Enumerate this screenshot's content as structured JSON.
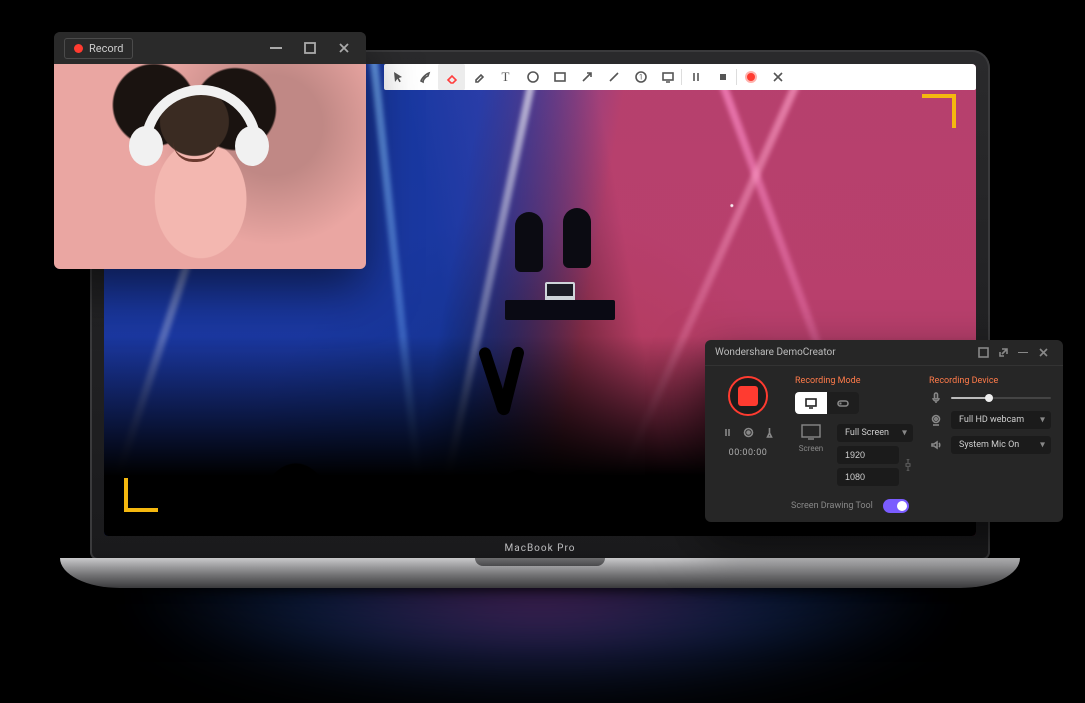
{
  "laptop": {
    "brand_label": "MacBook Pro"
  },
  "record_window": {
    "record_label": "Record",
    "colors": {
      "record_red": "#ff3b30"
    }
  },
  "annotation_toolbar": {
    "tools": [
      "cursor",
      "brush",
      "eraser",
      "highlighter",
      "text",
      "circle",
      "rectangle",
      "arrow",
      "line",
      "step-number",
      "whiteboard"
    ]
  },
  "panel": {
    "title": "Wondershare DemoCreator",
    "timer": "00:00:00",
    "recording_mode_label": "Recording Mode",
    "recording_device_label": "Recording Device",
    "screen_label": "Screen",
    "capture_area_selected": "Full Screen",
    "width": "1920",
    "height": "1080",
    "webcam_selected": "Full HD webcam",
    "mic_selected": "System Mic On",
    "drawing_tool_label": "Screen Drawing Tool",
    "drawing_tool_on": true
  }
}
